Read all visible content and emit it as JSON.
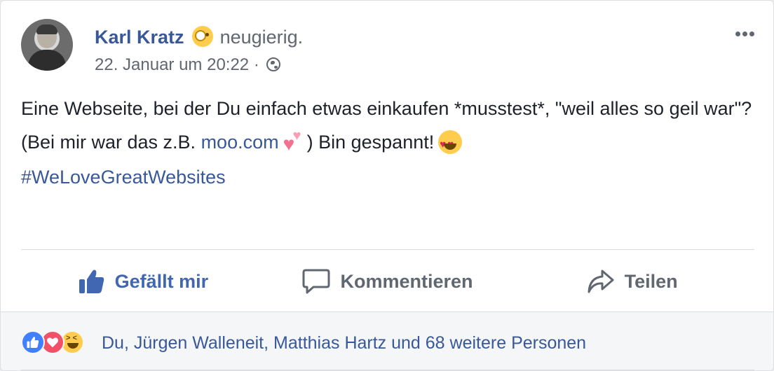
{
  "post": {
    "author": "Karl Kratz",
    "feeling": "neugierig.",
    "timestamp": "22. Januar um 20:22 ·",
    "body_line1": "Eine Webseite, bei der Du einfach etwas einkaufen *musstest*, \"weil alles so geil war\"?",
    "body_line2_prefix": "(Bei mir war das z.B. ",
    "body_link": "moo.com",
    "body_line2_suffix": ") Bin gespannt!",
    "hashtag": "#WeLoveGreatWebsites"
  },
  "actions": {
    "like_label": "Gefällt mir",
    "comment_label": "Kommentieren",
    "share_label": "Teilen"
  },
  "reactions": {
    "summary": "Du, Jürgen Walleneit, Matthias Hartz und 68 weitere Personen"
  },
  "icons": {
    "feeling": "curious-monocle-emoji",
    "privacy": "globe-icon",
    "more": "more-options-icon",
    "link_emoji": "revolving-hearts-emoji",
    "end_emoji": "heart-eyes-emoji"
  },
  "colors": {
    "link": "#385898",
    "like_action": "#4267b2",
    "muted": "#606770"
  }
}
